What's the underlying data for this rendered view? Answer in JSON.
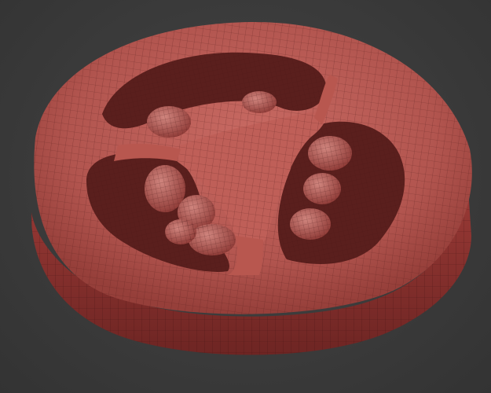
{
  "scene": {
    "subject": "tomato-slice-wireframe-mesh",
    "colors": {
      "background": "#3b3b3b",
      "flesh_light": "#c86a63",
      "flesh_mid": "#b2554f",
      "flesh_dark": "#7e2f2c",
      "skin_side": "#8f3431",
      "cavity_shadow": "#5a1f1d",
      "wire": "#4a1715"
    }
  }
}
